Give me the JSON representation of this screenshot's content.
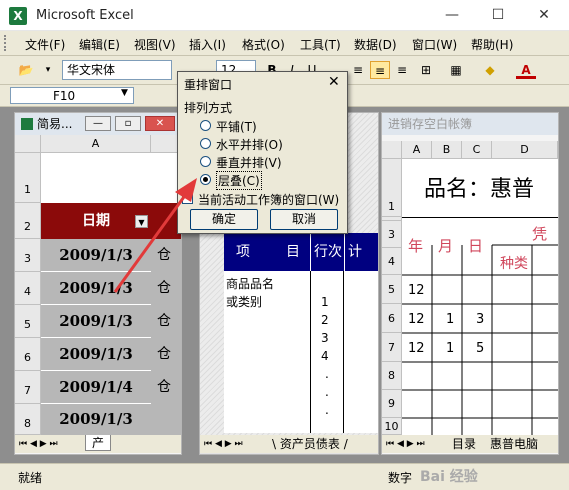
{
  "app": {
    "title": "Microsoft Excel",
    "icon_letter": "X"
  },
  "window_controls": [
    "—",
    "☐",
    "✕"
  ],
  "menu": [
    "文件(F)",
    "编辑(E)",
    "视图(V)",
    "插入(I)",
    "格式(O)",
    "工具(T)",
    "数据(D)",
    "窗口(W)",
    "帮助(H)"
  ],
  "toolbar": {
    "font_name": "华文宋体",
    "font_size": "12",
    "bold": "B",
    "italic": "I",
    "underline": "U",
    "font_color_label": "A"
  },
  "namebox": {
    "value": "F10"
  },
  "left_window": {
    "title": "简易...",
    "col_header": "A",
    "row_numbers": [
      "1",
      "2",
      "3",
      "4",
      "5",
      "6",
      "7",
      "8"
    ],
    "header_cell": "日期",
    "dates": [
      "2009/1/3",
      "2009/1/3",
      "2009/1/3",
      "2009/1/3",
      "2009/1/4",
      "2009/1/3"
    ],
    "next_col_char": "仓",
    "sheet_tab": "产"
  },
  "middle_window": {
    "table_header": [
      "项",
      "目",
      "行次",
      "计"
    ],
    "cells": [
      "商品品名",
      "或类别"
    ],
    "row_nums": [
      "1",
      "2",
      "3",
      "4",
      ".",
      ".",
      "."
    ],
    "sheet_tab": "资产员债表"
  },
  "right_window": {
    "title": "进销存空白帐簿",
    "col_headers": [
      "A",
      "B",
      "C",
      "D"
    ],
    "row_numbers": [
      "1",
      "2",
      "3",
      "4",
      "5",
      "6",
      "7",
      "8",
      "9",
      "10"
    ],
    "title_text": "品名：惠普",
    "cols": [
      "年",
      "月",
      "日"
    ],
    "header_right": "凭",
    "header_right2": "种类",
    "data_rows": [
      [
        "12",
        "",
        ""
      ],
      [
        "12",
        "1",
        "3"
      ],
      [
        "12",
        "1",
        "5"
      ]
    ],
    "sheet_tab": "目录",
    "sheet_tab2": "惠普电脑"
  },
  "dialog": {
    "title": "重排窗口",
    "group_label": "排列方式",
    "options": [
      "平铺(T)",
      "水平并排(O)",
      "垂直并排(V)",
      "层叠(C)"
    ],
    "selected_index": 3,
    "checkbox_label": "当前活动工作簿的窗口(W)",
    "checkbox_checked": false,
    "ok": "确定",
    "cancel": "取消"
  },
  "status": {
    "left": "就绪",
    "right": "数字"
  },
  "watermark": "Bai 经验",
  "colors": {
    "header_red": "#8b0a0a",
    "date_gray": "#b7b7b7",
    "table_blue": "#000080",
    "arrow_red": "#e23a3a",
    "right_text_red": "#d0475c"
  }
}
